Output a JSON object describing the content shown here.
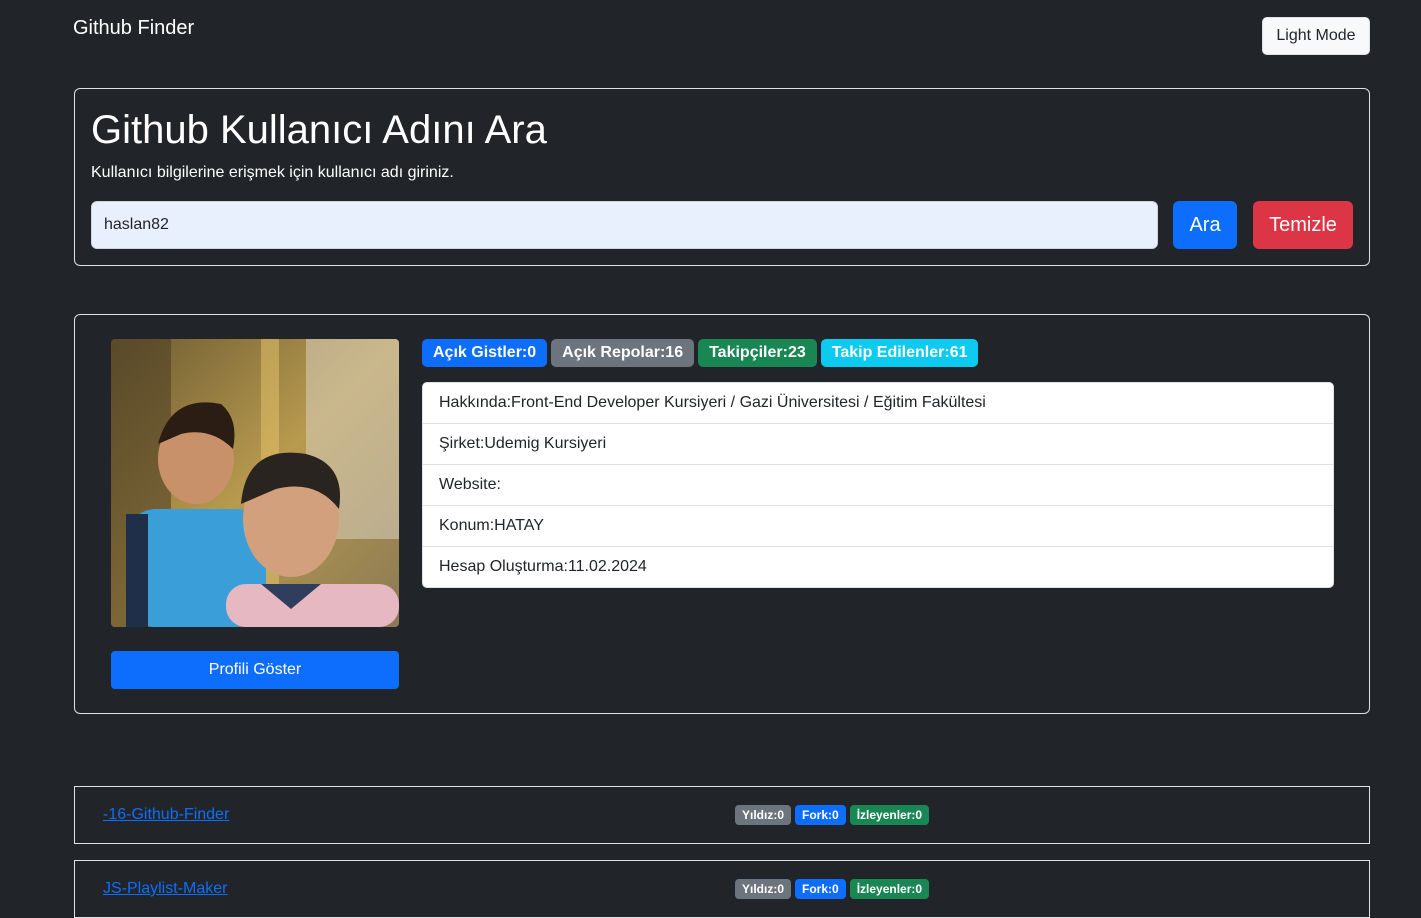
{
  "navbar": {
    "brand": "Github Finder",
    "mode_button": "Light Mode"
  },
  "search": {
    "title": "Github Kullanıcı Adını Ara",
    "subtitle": "Kullanıcı bilgilerine erişmek için kullanıcı adı giriniz.",
    "input_value": "haslan82",
    "search_button": "Ara",
    "clear_button": "Temizle"
  },
  "profile": {
    "show_profile_button": "Profili Göster",
    "badges": [
      {
        "label": "Açık Gistler:0",
        "color": "#0d6efd"
      },
      {
        "label": "Açık Repolar:16",
        "color": "#6c757d"
      },
      {
        "label": "Takipçiler:23",
        "color": "#198754"
      },
      {
        "label": "Takip Edilenler:61",
        "color": "#0dcaf0"
      }
    ],
    "info": [
      "Hakkında:Front-End Developer Kursiyeri / Gazi Üniversitesi / Eğitim Fakültesi",
      "Şirket:Udemig Kursiyeri",
      "Website:",
      "Konum:HATAY",
      "Hesap Oluşturma:11.02.2024"
    ]
  },
  "repos": [
    {
      "name": "-16-Github-Finder",
      "stars": "Yıldız:0",
      "forks": "Fork:0",
      "watchers": "İzleyenler:0"
    },
    {
      "name": "JS-Playlist-Maker",
      "stars": "Yıldız:0",
      "forks": "Fork:0",
      "watchers": "İzleyenler:0"
    }
  ]
}
